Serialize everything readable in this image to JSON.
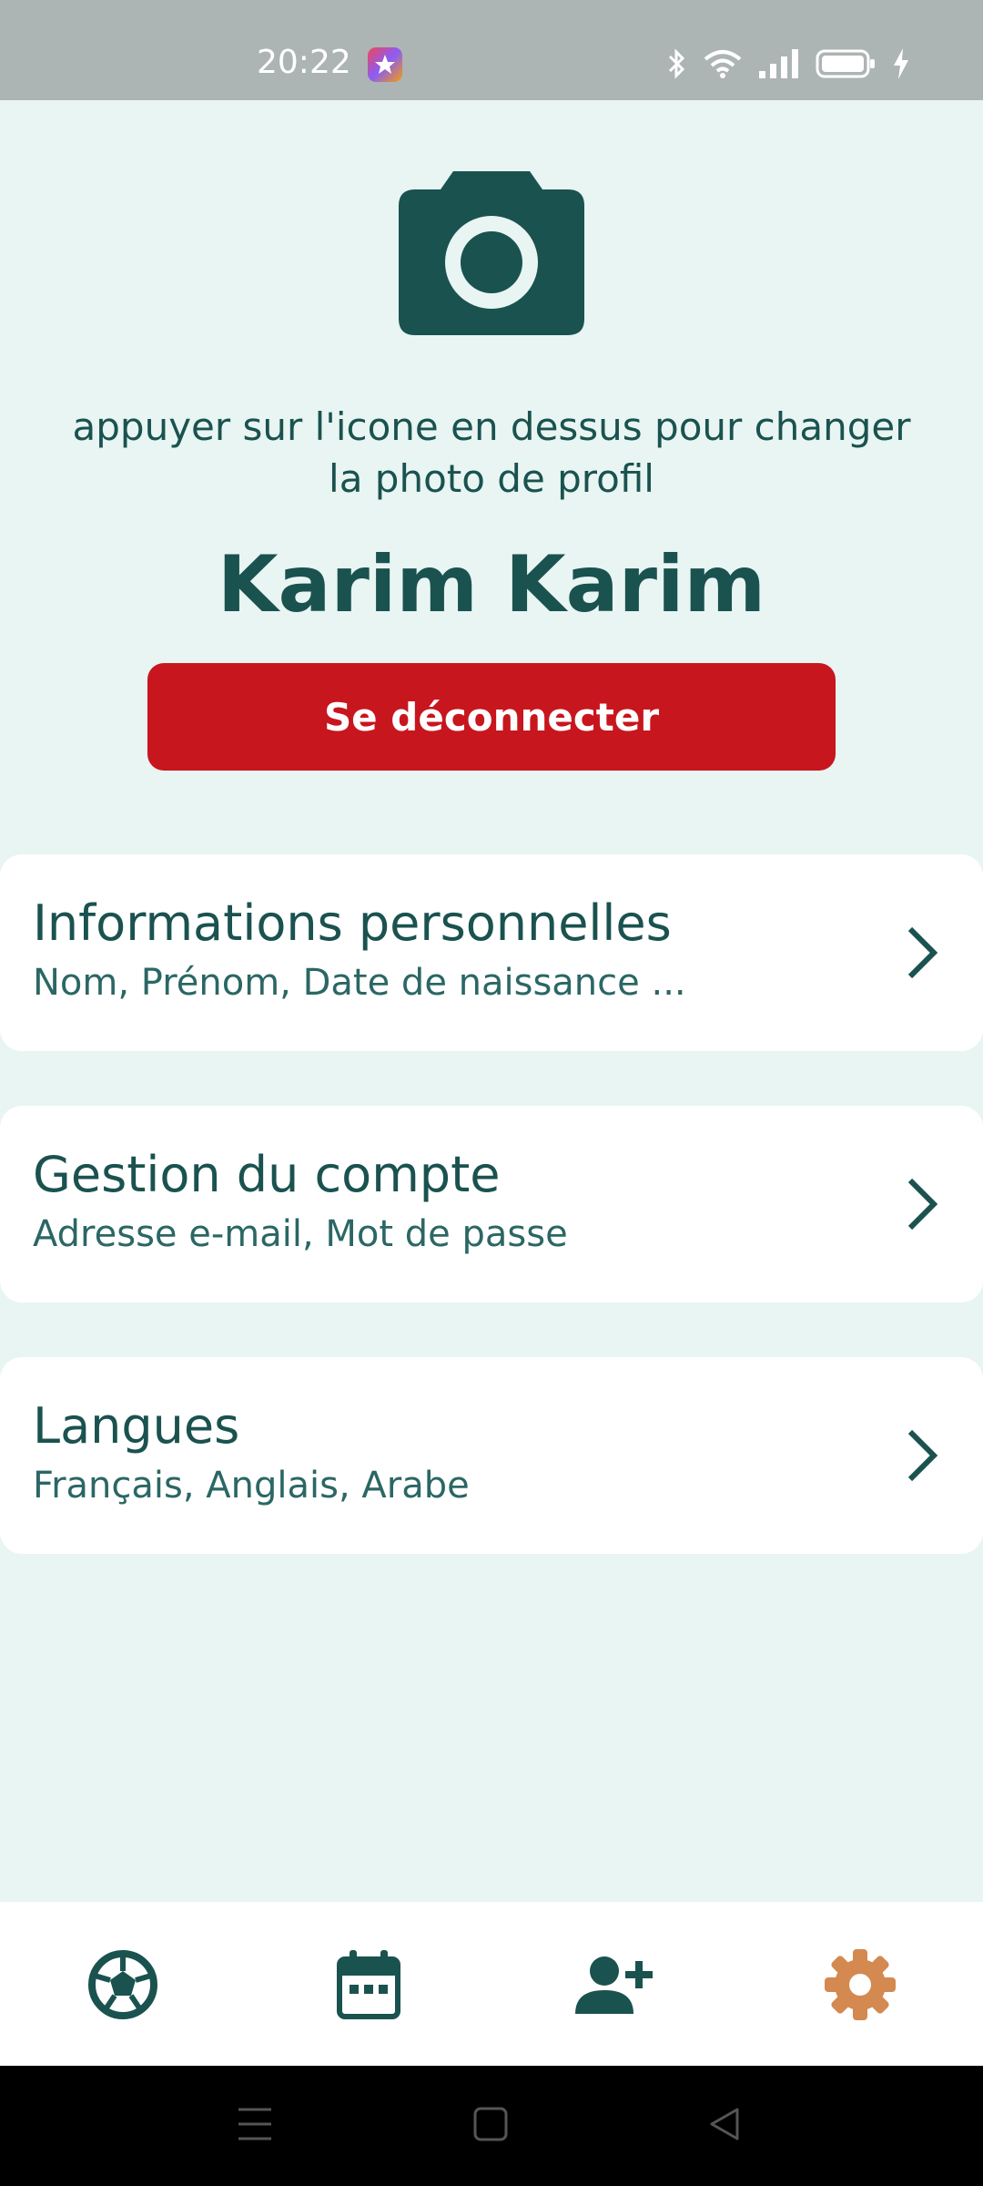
{
  "status_bar": {
    "time": "20:22",
    "icons": [
      "app-notification-icon",
      "bluetooth-icon",
      "wifi-icon",
      "signal-icon",
      "battery-icon",
      "charging-icon"
    ]
  },
  "profile": {
    "photo_icon": "camera-icon",
    "hint": "appuyer sur l'icone en dessus pour changer la photo de profil",
    "name": "Karim Karim",
    "logout_label": "Se déconnecter"
  },
  "settings": [
    {
      "title": "Informations personnelles",
      "subtitle": "Nom, Prénom, Date de naissance ..."
    },
    {
      "title": "Gestion du compte",
      "subtitle": "Adresse e-mail, Mot de passe"
    },
    {
      "title": "Langues",
      "subtitle": "Français, Anglais, Arabe"
    }
  ],
  "bottom_nav": {
    "items": [
      {
        "icon": "soccer-ball-icon",
        "active": false
      },
      {
        "icon": "calendar-icon",
        "active": false
      },
      {
        "icon": "add-person-icon",
        "active": false
      },
      {
        "icon": "gear-icon",
        "active": true
      }
    ]
  },
  "system_nav": [
    "menu-icon",
    "home-icon",
    "back-icon"
  ],
  "colors": {
    "primary": "#1a524f",
    "background": "#e8f5f2",
    "danger": "#c8161e",
    "accent_active": "#d3894f",
    "status_bar": "#adb4b4"
  }
}
